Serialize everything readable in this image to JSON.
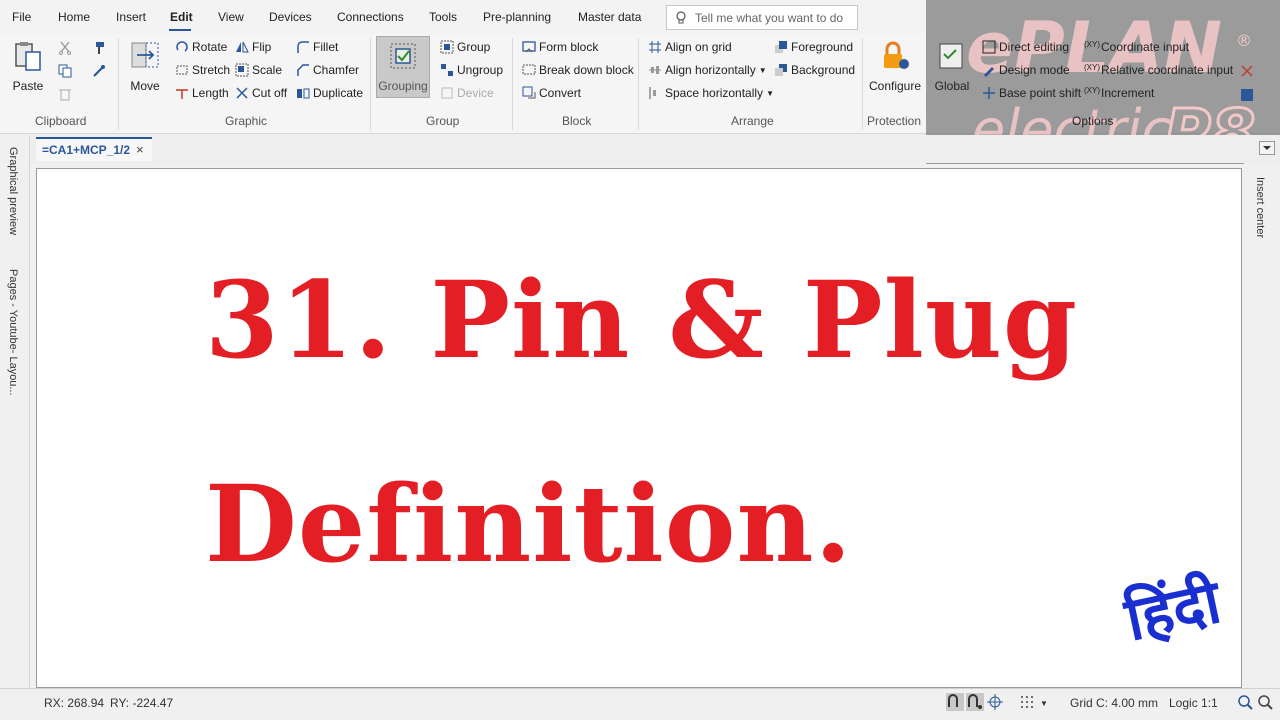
{
  "menu": {
    "items": [
      "File",
      "Home",
      "Insert",
      "Edit",
      "View",
      "Devices",
      "Connections",
      "Tools",
      "Pre-planning",
      "Master data"
    ],
    "active": "Edit",
    "search_placeholder": "Tell me what you want to do"
  },
  "ribbon": {
    "clipboard": {
      "label": "Clipboard",
      "paste": "Paste"
    },
    "graphic": {
      "label": "Graphic",
      "move": "Move",
      "rotate": "Rotate",
      "stretch": "Stretch",
      "length": "Length",
      "flip": "Flip",
      "scale": "Scale",
      "cut_off": "Cut off",
      "fillet": "Fillet",
      "chamfer": "Chamfer",
      "duplicate": "Duplicate"
    },
    "group": {
      "label": "Group",
      "grouping": "Grouping",
      "group": "Group",
      "ungroup": "Ungroup",
      "device": "Device"
    },
    "block": {
      "label": "Block",
      "form_block": "Form block",
      "break_down_block": "Break down block",
      "convert": "Convert"
    },
    "arrange": {
      "label": "Arrange",
      "align_on_grid": "Align on grid",
      "align_horizontally": "Align horizontally",
      "space_horizontally": "Space horizontally",
      "foreground": "Foreground",
      "background": "Background"
    },
    "protection": {
      "label": "Protection",
      "configure": "Configure"
    },
    "options": {
      "label": "Options",
      "global": "Global",
      "direct_editing": "Direct editing",
      "design_mode": "Design mode",
      "base_point_shift": "Base point shift",
      "coordinate_input": "Coordinate input",
      "relative_coordinate_input": "Relative coordinate input",
      "increment": "Increment"
    }
  },
  "logo": {
    "brand": "ePLAN",
    "product": "electric",
    "version": "P8"
  },
  "document_tab": {
    "label": "=CA1+MCP_1/2",
    "close": "×"
  },
  "side_panels": {
    "left_top": "Graphical preview",
    "left_bottom": "Pages - Youtube- Layou...",
    "right": "Insert center"
  },
  "canvas": {
    "title_line1": "31. Pin & Plug",
    "title_line2": "Definition.",
    "language_badge": "हिंदी"
  },
  "status": {
    "rx": "RX: 268.94",
    "ry": "RY: -224.47",
    "grid": "Grid C: 4.00 mm",
    "logic": "Logic 1:1"
  },
  "colors": {
    "title_red": "#e31e24",
    "hindi_blue": "#1a2fd0",
    "accent": "#2b579a"
  }
}
